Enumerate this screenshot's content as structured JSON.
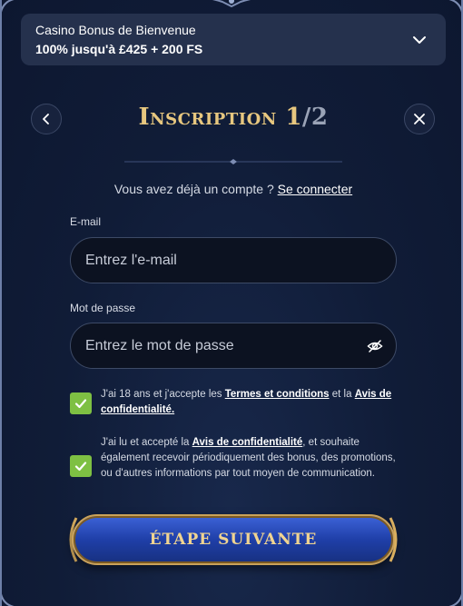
{
  "bonus": {
    "title": "Casino Bonus de Bienvenue",
    "amount": "100% jusqu'à £425 + 200 FS"
  },
  "header": {
    "title": "Inscription 1",
    "step": "/2"
  },
  "login_prompt": {
    "text": "Vous avez déjà un compte ?",
    "link": "Se connecter"
  },
  "email": {
    "label": "E-mail",
    "placeholder": "Entrez l'e-mail",
    "value": ""
  },
  "password": {
    "label": "Mot de passe",
    "placeholder": "Entrez le mot de passe",
    "value": ""
  },
  "consent_terms": {
    "checked": true,
    "text_before": "J'ai 18 ans et j'accepte les",
    "link1": "Termes et conditions",
    "text_mid": "et la",
    "link2": "Avis de confidentialité."
  },
  "consent_marketing": {
    "checked": true,
    "text_before": "J'ai lu et accepté la",
    "link": "Avis de confidentialité",
    "text_after": ", et souhaite également recevoir périodiquement des bonus, des promotions, ou d'autres informations par tout moyen de communication."
  },
  "next_button": {
    "label": "Étape suivante"
  },
  "colors": {
    "gold": "#e7c77f",
    "checkbox_green": "#7ec043",
    "button_blue": "#1f3fa8",
    "background": "#0e1a33"
  },
  "icons": [
    "chevron-down-icon",
    "chevron-left-icon",
    "close-icon",
    "eye-off-icon",
    "checkmark-icon"
  ]
}
